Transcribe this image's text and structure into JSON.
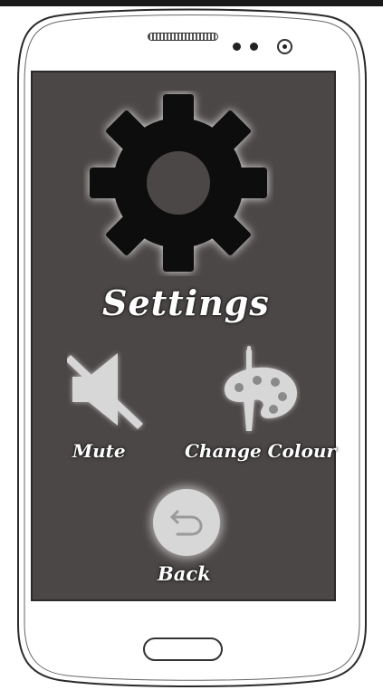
{
  "screen": {
    "title": "Settings",
    "options": {
      "mute_label": "Mute",
      "colour_label": "Change Colour"
    },
    "back_label": "Back"
  },
  "icons": {
    "title": "gear-icon",
    "mute": "speaker-muted-icon",
    "colour": "palette-brush-icon",
    "back": "back-arrow-icon"
  },
  "colors": {
    "screen_bg": "#4b4746",
    "text": "#ffffff",
    "gear": "#111111",
    "icon_fill": "#d7d7d7"
  }
}
